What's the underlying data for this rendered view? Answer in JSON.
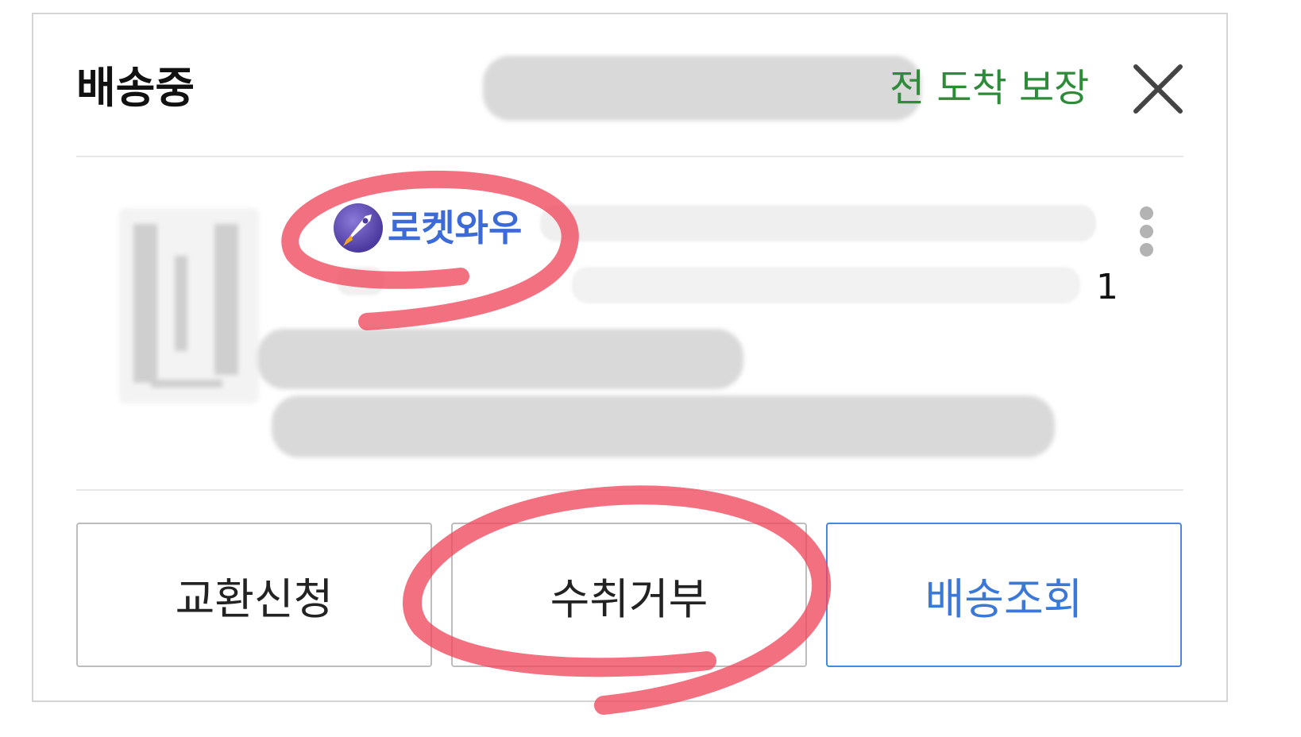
{
  "header": {
    "status_label": "배송중",
    "guarantee_text": "전 도착 보장",
    "close_icon": "close-icon"
  },
  "product": {
    "badge_icon": "rocket-icon",
    "badge_label": "로켓와우",
    "quantity": "1",
    "menu_icon": "kebab-menu-icon"
  },
  "actions": [
    {
      "label": "교환신청"
    },
    {
      "label": "수취거부"
    },
    {
      "label": "배송조회"
    }
  ],
  "colors": {
    "guarantee_green": "#2e8b3a",
    "primary_blue": "#3b78d8",
    "annotation_red": "#f0485c"
  }
}
